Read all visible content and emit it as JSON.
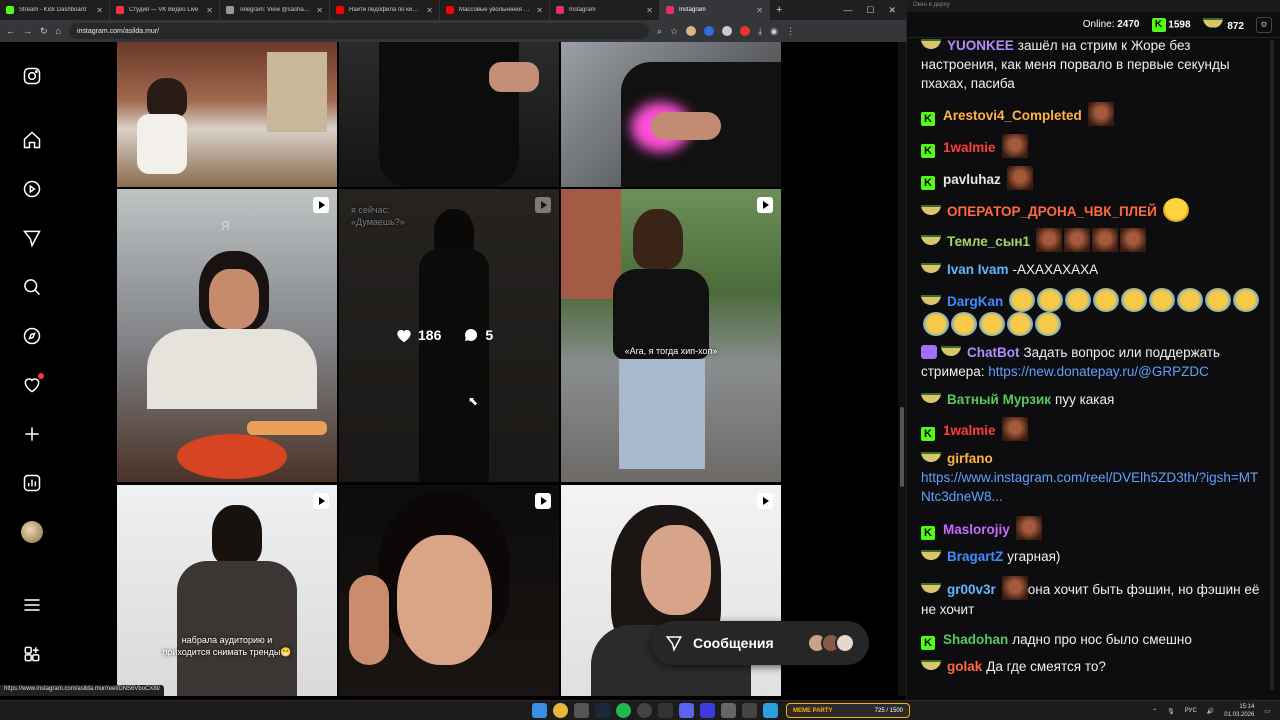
{
  "browser": {
    "tabs": [
      {
        "label": "Stream - Kick Dashboard",
        "color": "#53fc18"
      },
      {
        "label": "Студия — VK Видео Live",
        "color": "#ff3040"
      },
      {
        "label": "Telegram: View @sashakon",
        "color": "#999999"
      },
      {
        "label": "Найти педофила по кирпи...",
        "color": "#ff0000"
      },
      {
        "label": "Массовые увольнения 2025...",
        "color": "#ff0000"
      },
      {
        "label": "Instagram",
        "color": "#e1306c"
      },
      {
        "label": "Instagram",
        "color": "#e1306c",
        "active": true
      }
    ],
    "new_tab": "+",
    "url": "instagram.com/asilda.mur/",
    "status_link": "https://www.instagram.com/asilda.mur/reel/DNS6VboCX8t/"
  },
  "instagram": {
    "posts": {
      "p4_caption_top": "я сейчас:\n«Думаешь?»",
      "p5_caption": "«Ага, я тогда хип-хоп»",
      "p6_caption": "набрала аудиторию и\nприходится снимать тренды😁",
      "p3_watermark": "Я"
    },
    "hover_stats": {
      "likes": "186",
      "comments": "5"
    },
    "messages_label": "Сообщения"
  },
  "chat": {
    "window_title": "Окно в дерху",
    "online_label": "Online:",
    "online_count": "2470",
    "followers": "1598",
    "subs": "872",
    "messages": [
      {
        "badge": "bowl",
        "user": "YUONKEE",
        "color": "#b28cff",
        "text": "зашёл на стрим к Жоре без настроения, как меня порвало в первые секунды пхахах, пасиба"
      },
      {
        "badge": "k",
        "user": "Arestovi4_Completed",
        "color": "#ffb347",
        "text": ""
      },
      {
        "badge": "k",
        "user": "1walmie",
        "color": "#ff3c3c",
        "text": ""
      },
      {
        "badge": "k",
        "user": "pavluhaz",
        "color": "#e6e6e6",
        "text": ""
      },
      {
        "badge": "bowl",
        "user": "ОПЕРАТОР_ДРОНА_ЧВК_ПЛЕЙ",
        "color": "#ff6a3d",
        "text": ""
      },
      {
        "badge": "bowl",
        "user": "Темле_сын1",
        "color": "#a2d86a",
        "text": ""
      },
      {
        "badge": "bowl",
        "user": "Ivan Ivam",
        "color": "#5eb8ff",
        "text": "-АХАХАХАХА"
      },
      {
        "badge": "bowl",
        "user": "DargKan",
        "color": "#3f8cff",
        "text": ""
      },
      {
        "badge": "bot",
        "user": "ChatBot",
        "color": "#b28cff",
        "text": "Задать вопрос или поддержать стримера: ",
        "link": "https://new.donatepay.ru/@GRPZDC"
      },
      {
        "badge": "bowl",
        "user": "Ватный Мурзик",
        "color": "#57c95d",
        "text": "пуу какая"
      },
      {
        "badge": "k",
        "user": "1walmie",
        "color": "#ff3c3c",
        "text": ""
      },
      {
        "badge": "bowl",
        "user": "girfano",
        "color": "#ffb347",
        "text": "",
        "link": "https://www.instagram.com/reel/DVElh5ZD3th/?igsh=MTNtc3dneW8..."
      },
      {
        "badge": "k",
        "user": "Maslorojiy",
        "color": "#c56cff",
        "text": ""
      },
      {
        "badge": "bowl",
        "user": "BragartZ",
        "color": "#3f8cff",
        "text": "угарная)"
      },
      {
        "badge": "bowl",
        "user": "gr00v3r",
        "color": "#5eb8ff",
        "text": "она хочит быть фэшин, но фэшин её не хочит"
      },
      {
        "badge": "k",
        "user": "Shadohan",
        "color": "#57c95d",
        "text": "ладно про нос было смешно"
      },
      {
        "badge": "bowl",
        "user": "golak",
        "color": "#ff6a3d",
        "text": "Да где смеятся то?"
      }
    ]
  },
  "taskbar": {
    "meme_label": "MEME PARTY",
    "meme_progress": "725 / 1500",
    "lang": "РУС",
    "time": "15:14",
    "date": "01.03.2026"
  }
}
